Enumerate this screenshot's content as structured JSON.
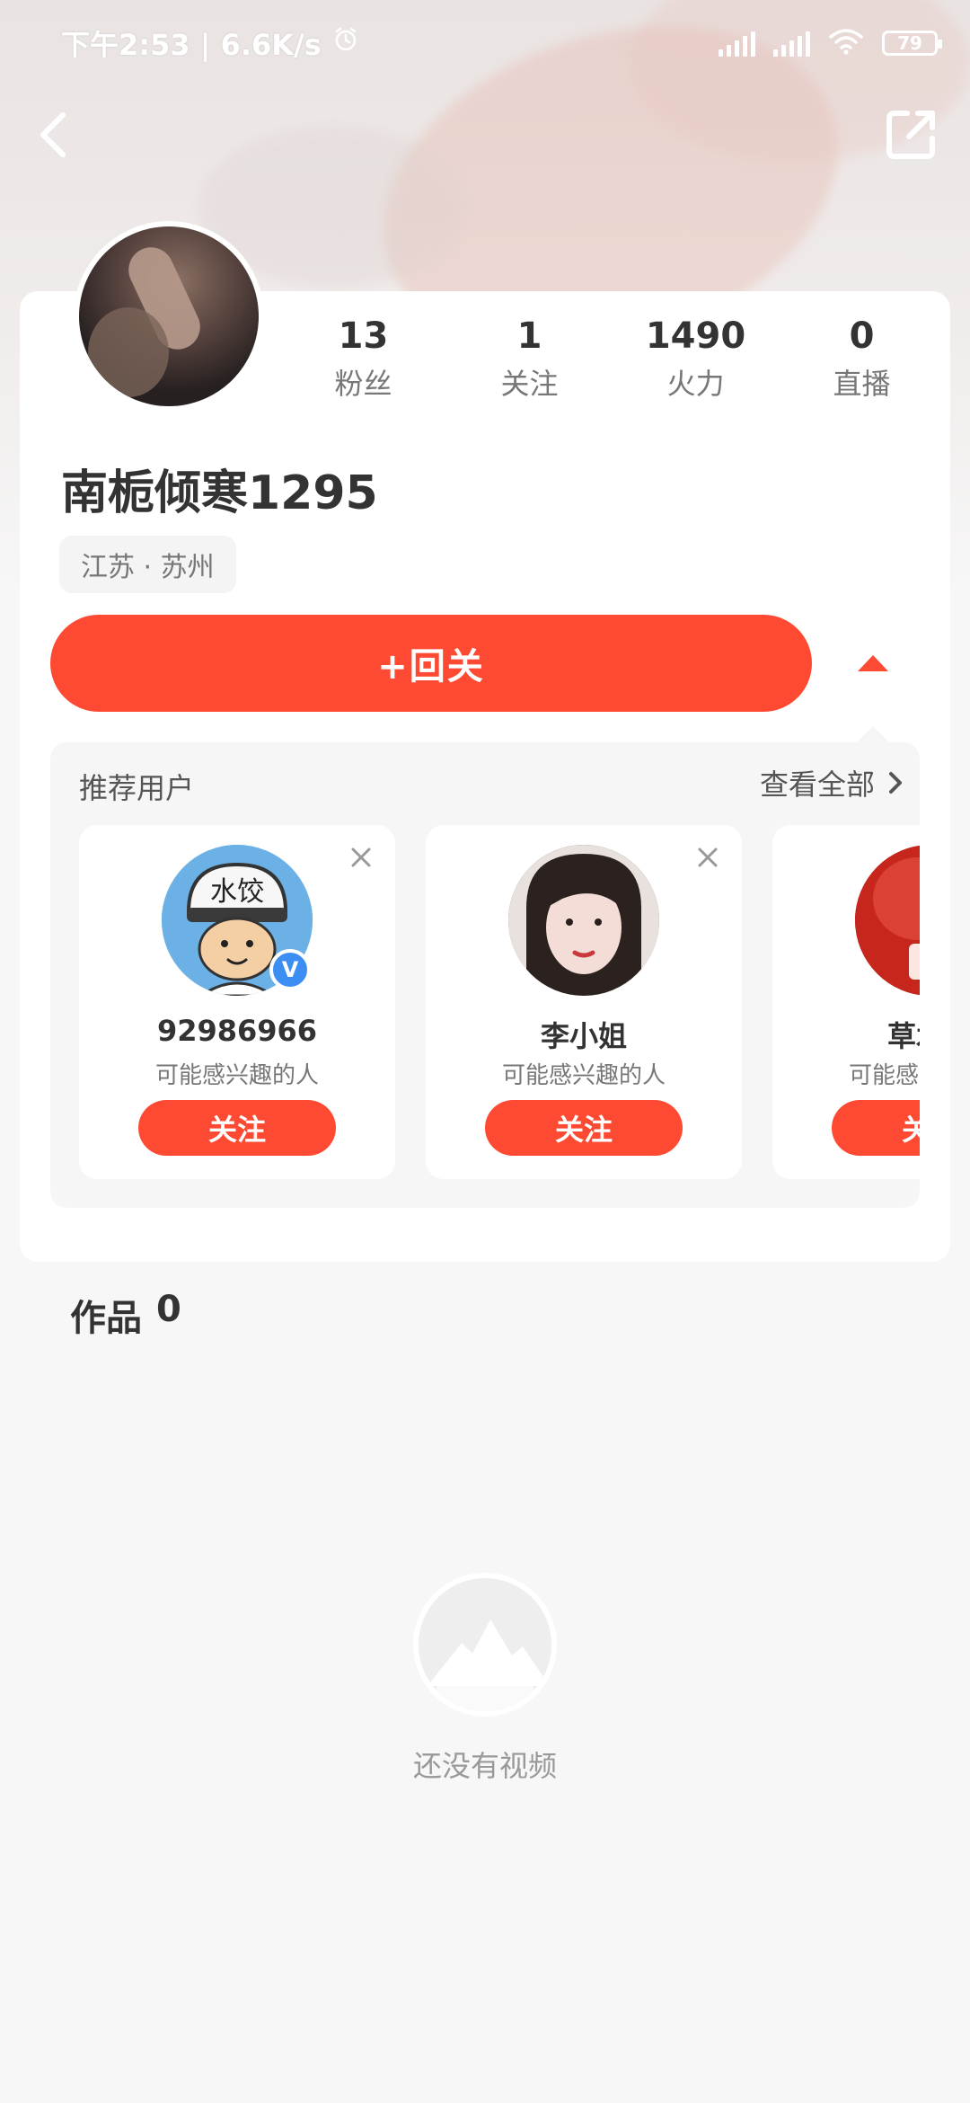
{
  "status_bar": {
    "time_speed": "下午2:53 | 6.6K/s",
    "battery": "79"
  },
  "profile": {
    "username": "南栀倾寒1295",
    "location": "江苏 · 苏州",
    "stats": [
      {
        "value": "13",
        "label": "粉丝"
      },
      {
        "value": "1",
        "label": "关注"
      },
      {
        "value": "1490",
        "label": "火力"
      },
      {
        "value": "0",
        "label": "直播"
      }
    ],
    "follow_back_label": "+回关"
  },
  "recommend": {
    "title": "推荐用户",
    "view_all": "查看全部",
    "users": [
      {
        "name": "92986966",
        "reason": "可能感兴趣的人",
        "follow": "关注",
        "hat_text": "水饺"
      },
      {
        "name": "李小姐",
        "reason": "可能感兴趣的人",
        "follow": "关注"
      },
      {
        "name": "草木川",
        "reason": "可能感兴趣的人",
        "follow": "关注"
      }
    ]
  },
  "works": {
    "label": "作品",
    "count": "0"
  },
  "empty": {
    "text": "还没有视频"
  },
  "colors": {
    "accent": "#fe4a32",
    "verify": "#3c8ef3"
  }
}
